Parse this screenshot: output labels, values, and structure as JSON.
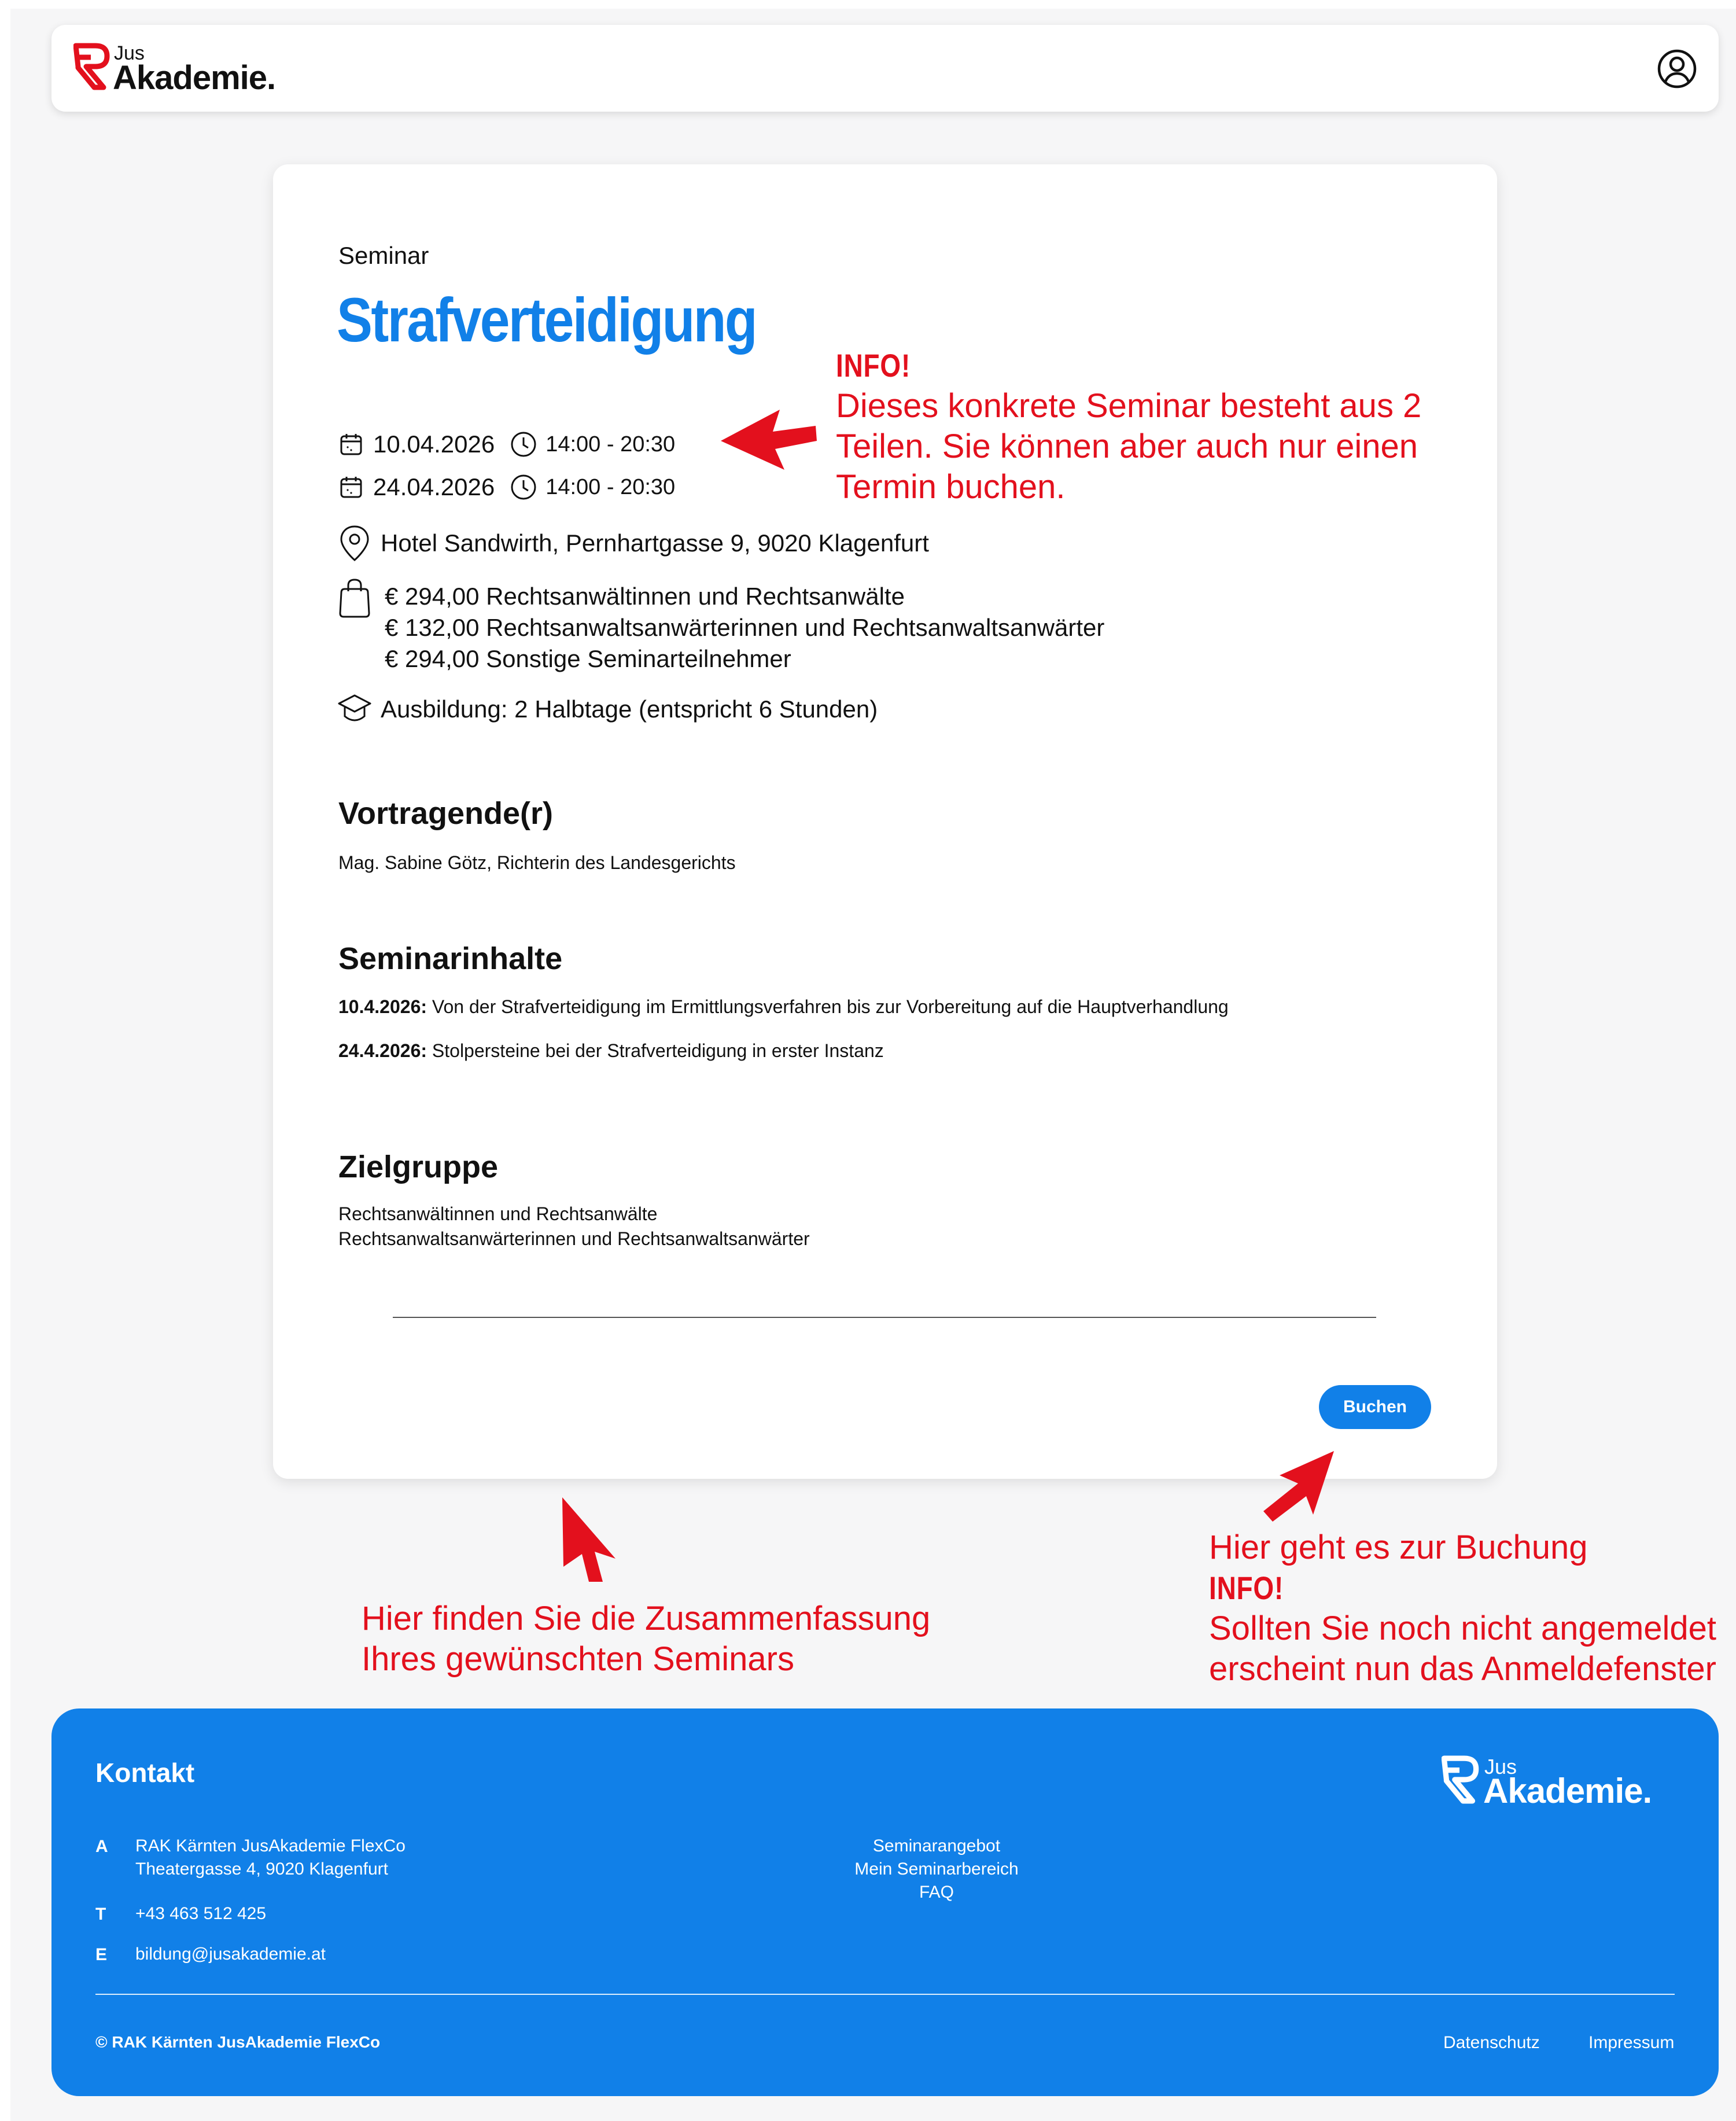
{
  "brand": {
    "small": "Jus",
    "name": "Akademie",
    "dot": ".",
    "accent": "#e3101d"
  },
  "header": {
    "user_icon": "user-circle-icon"
  },
  "seminar": {
    "kicker": "Seminar",
    "title": "Strafverteidigung",
    "dates": [
      {
        "date": "10.04.2026",
        "time": "14:00 - 20:30"
      },
      {
        "date": "24.04.2026",
        "time": "14:00 - 20:30"
      }
    ],
    "location": "Hotel Sandwirth, Pernhartgasse 9, 9020 Klagenfurt",
    "prices": [
      "€ 294,00 Rechtsanwältinnen und Rechtsanwälte",
      "€ 132,00 Rechtsanwaltsanwärterinnen und Rechtsanwaltsanwärter",
      "€ 294,00 Sonstige Seminarteilnehmer"
    ],
    "training": "Ausbildung: 2 Halbtage (entspricht 6 Stunden)",
    "speaker_heading": "Vortragende(r)",
    "speaker": "Mag. Sabine Götz, Richterin des Landesgerichts",
    "contents_heading": "Seminarinhalte",
    "contents": [
      {
        "date": "10.4.2026:",
        "text": " Von der Strafverteidigung im Ermittlungsverfahren bis zur Vorbereitung auf die Hauptverhandlung"
      },
      {
        "date": "24.4.2026:",
        "text": " Stolpersteine bei der Strafverteidigung in erster Instanz"
      }
    ],
    "target_heading": "Zielgruppe",
    "target": [
      "Rechtsanwältinnen und Rechtsanwälte",
      "Rechtsanwaltsanwärterinnen und Rechtsanwaltsanwärter"
    ],
    "book_button": "Buchen"
  },
  "annotations": {
    "color": "#e3101d",
    "parts": {
      "info": "INFO!",
      "lines": [
        "Dieses konkrete Seminar besteht aus 2",
        "Teilen. Sie können aber auch nur einen",
        "Termin buchen."
      ]
    },
    "summary": {
      "lines": [
        "Hier finden Sie die Zusammenfassung",
        "Ihres gewünschten Seminars"
      ]
    },
    "booking": {
      "line1": "Hier geht es zur Buchung",
      "info": "INFO!",
      "lines": [
        "Sollten Sie noch nicht angemeldet",
        "erscheint nun das Anmeldefenster"
      ]
    }
  },
  "footer": {
    "title": "Kontakt",
    "address_label": "A",
    "address_lines": [
      "RAK Kärnten JusAkademie FlexCo",
      "Theatergasse 4, 9020 Klagenfurt"
    ],
    "phone_label": "T",
    "phone": "+43 463 512 425",
    "email_label": "E",
    "email": "bildung@jusakademie.at",
    "links": [
      "Seminarangebot",
      "Mein Seminarbereich",
      "FAQ"
    ],
    "copyright": "© RAK Kärnten JusAkademie FlexCo",
    "privacy": "Datenschutz",
    "imprint": "Impressum",
    "background": "#1180e8"
  }
}
